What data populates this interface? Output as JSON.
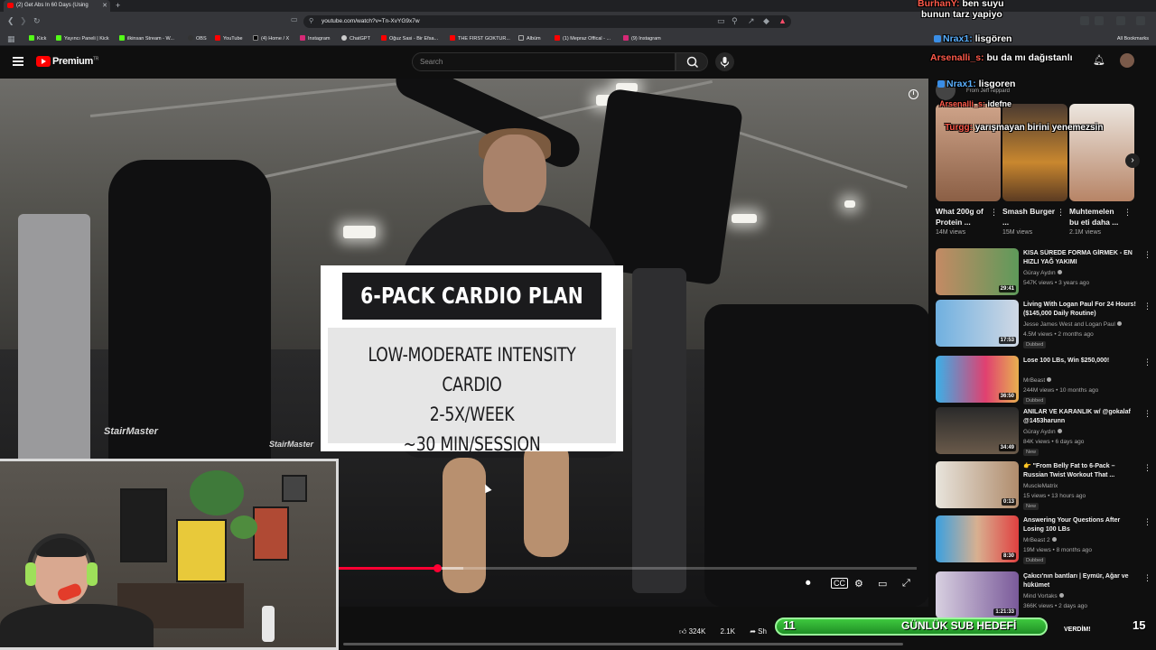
{
  "browser": {
    "tab_title": "(2) Get Abs In 60 Days (Using",
    "url": "youtube.com/watch?v=Tn-XvYG9x7w",
    "bookmarks": [
      "Kick",
      "Yayıncı Paneli | Kick",
      "ilkinsan Stream - W...",
      "OBS",
      "YouTube",
      "(4) Home / X",
      "Instagram",
      "ChatGPT",
      "Oğuz Sasi - Bir Efsa...",
      "THE FIRST GOKTUR...",
      "Albüm",
      "(1) Mepraz Offical - ...",
      "(9) Instagram"
    ],
    "all_bookmarks": "All Bookmarks"
  },
  "youtube": {
    "logo": "Premium",
    "logo_sup": "TR",
    "search_placeholder": "Search"
  },
  "video": {
    "card_title": "6-PACK CARDIO PLAN",
    "card_lines": [
      "LOW-MODERATE INTENSITY CARDIO",
      "2-5X/WEEK",
      "~30 MIN/SESSION"
    ],
    "machine_brand": "StairMaster",
    "progress_fraction": 0.17,
    "buffer_fraction": 0.215
  },
  "actions": {
    "likes": "324K",
    "views": "2.1K",
    "share": "Sh"
  },
  "sidebar": {
    "from_label": "From Jeff Nippard",
    "shorts": [
      {
        "title": "What 200g of Protein ...",
        "views": "14M views"
      },
      {
        "title": "Smash Burger ...",
        "views": "15M views"
      },
      {
        "title": "Muhtemelen bu eti daha ...",
        "views": "2.1M views"
      }
    ],
    "videos": [
      {
        "title": "KISA SÜREDE FORMA GİRMEK - EN HIZLI YAĞ YAKIMI",
        "channel": "Güray Aydın",
        "meta": "547K views • 3 years ago",
        "duration": "29:41",
        "badge": ""
      },
      {
        "title": "Living With Logan Paul For 24 Hours! ($145,000 Daily Routine)",
        "channel": "Jesse James West and Logan Paul",
        "meta": "4.5M views • 2 months ago",
        "duration": "17:53",
        "badge": "Dubbed"
      },
      {
        "title": "Lose 100 LBs, Win $250,000!",
        "channel": "MrBeast",
        "meta": "244M views • 10 months ago",
        "duration": "36:50",
        "badge": "Dubbed"
      },
      {
        "title": "ANILAR VE KARANLIK w/ @gokalaf @1453harunn",
        "channel": "Güray Aydın",
        "meta": "84K views • 6 days ago",
        "duration": "34:49",
        "badge": "New"
      },
      {
        "title": "👉 \"From Belly Fat to 6-Pack – Russian Twist Workout That ...",
        "channel": "MuscleMatrix",
        "meta": "15 views • 13 hours ago",
        "duration": "0:13",
        "badge": "New"
      },
      {
        "title": "Answering Your Questions After Losing 100 LBs",
        "channel": "MrBeast 2",
        "meta": "19M views • 8 months ago",
        "duration": "8:30",
        "badge": "Dubbed"
      },
      {
        "title": "Çakıcı'nın bantları | Eymür, Ağar ve hükümet",
        "channel": "Mind Vortaks",
        "meta": "366K views • 2 days ago",
        "duration": "1:21:33",
        "badge": ""
      }
    ]
  },
  "chat": [
    {
      "user": "BurhanY:",
      "text": "ben suyu",
      "style": "red"
    },
    {
      "user": "",
      "text": "bunun tarz yapiyo",
      "style": "red"
    },
    {
      "user": "Nrax1:",
      "text": "lisgören",
      "style": "blue"
    },
    {
      "user": "Arsenalli_s:",
      "text": "bu da mı dağıstanlı",
      "style": "red"
    },
    {
      "user": "Nrax1:",
      "text": "lisgoren",
      "style": "blue"
    },
    {
      "user": "Arsenalli_s:",
      "text": "idefne",
      "style": "red"
    },
    {
      "user": "Turgg:",
      "text": "yarışmayan birini yenemezsin",
      "style": "red"
    }
  ],
  "overlay": {
    "goal_left": "11",
    "goal_text": "GÜNLÜK SUB HEDEFİ",
    "goal_right": "15",
    "sub_text": "VERDİM!"
  },
  "colors": {
    "yt_red": "#ff0000",
    "progress": "#ff0033",
    "goal_green": "#2fb336"
  }
}
